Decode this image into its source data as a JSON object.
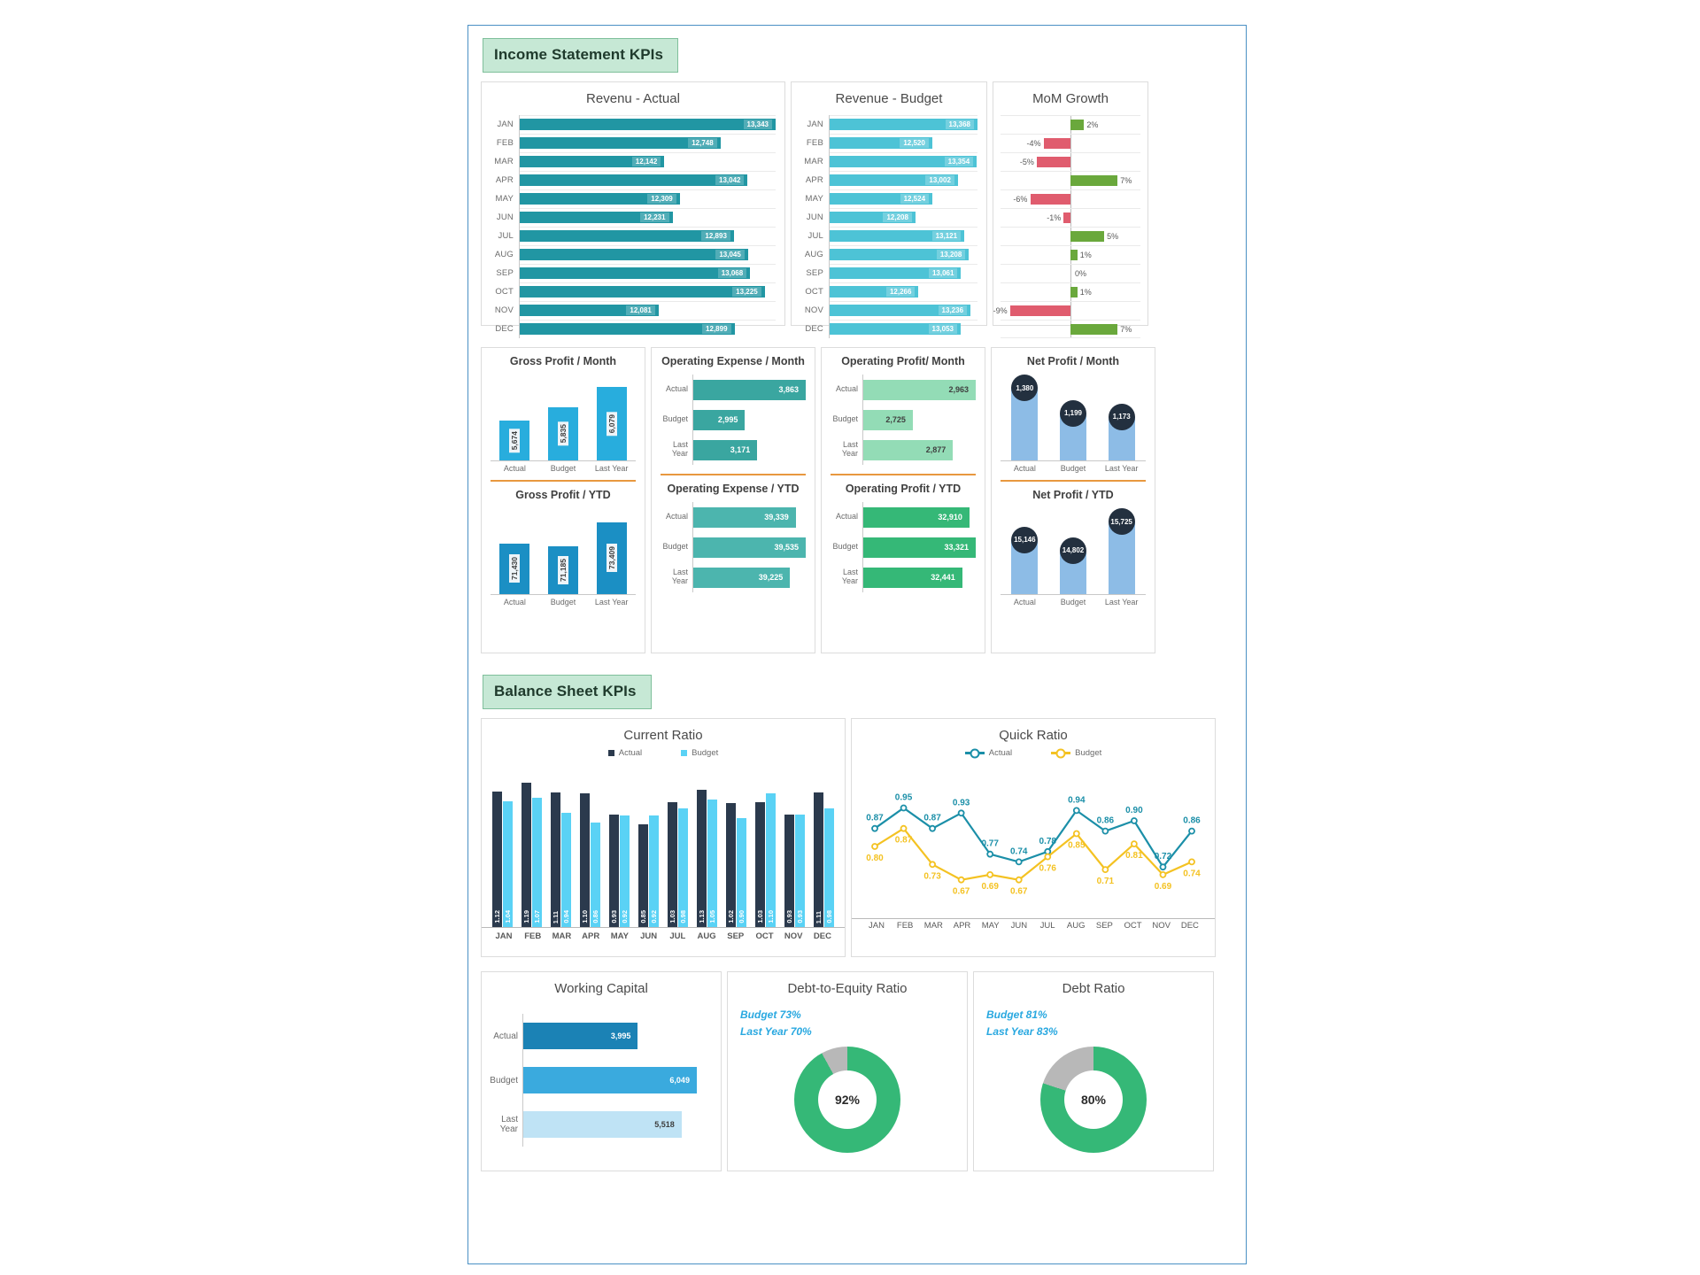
{
  "sections": {
    "income": "Income Statement KPIs",
    "balance": "Balance Sheet KPIs"
  },
  "titles": {
    "revenue_actual": "Revenu - Actual",
    "revenue_budget": "Revenue - Budget",
    "mom_growth": "MoM Growth",
    "gross_profit_month": "Gross Profit / Month",
    "gross_profit_ytd": "Gross Profit / YTD",
    "opex_month": "Operating Expense / Month",
    "opex_ytd": "Operating Expense / YTD",
    "opprofit_month": "Operating Profit/ Month",
    "opprofit_ytd": "Operating Profit / YTD",
    "netprofit_month": "Net Profit / Month",
    "netprofit_ytd": "Net Profit / YTD",
    "current_ratio": "Current Ratio",
    "quick_ratio": "Quick Ratio",
    "working_capital": "Working Capital",
    "debt_to_equity": "Debt-to-Equity Ratio",
    "debt_ratio": "Debt Ratio"
  },
  "legends": {
    "actual": "Actual",
    "budget": "Budget"
  },
  "cat_labels": {
    "actual": "Actual",
    "budget": "Budget",
    "last_year": "Last Year",
    "last_year_2l": "Last Year"
  },
  "colors": {
    "teal_dark": "#2196a3",
    "teal_light": "#4dc3d6",
    "green": "#6aa83c",
    "red": "#e05c6e",
    "blue_light": "#28addd",
    "blue_mid": "#1b8fc4",
    "navy": "#2b3a4d",
    "cyan": "#5ad2f5",
    "donut_green": "#35b877",
    "donut_grey": "#b8b8b8",
    "note_blue": "#29a8e0",
    "banner_green": "#c6e8d5",
    "divider_orange": "#e8983f"
  },
  "chart_data": [
    {
      "type": "bar",
      "title": "Revenu - Actual",
      "orientation": "horizontal",
      "categories": [
        "JAN",
        "FEB",
        "MAR",
        "APR",
        "MAY",
        "JUN",
        "JUL",
        "AUG",
        "SEP",
        "OCT",
        "NOV",
        "DEC"
      ],
      "values": [
        13343,
        12748,
        12142,
        13042,
        12309,
        12231,
        12893,
        13045,
        13068,
        13225,
        12081,
        12899
      ],
      "labels": [
        "13,343",
        "12,748",
        "12,142",
        "13,042",
        "12,309",
        "12,231",
        "12,893",
        "13,045",
        "13,068",
        "13,225",
        "12,081",
        "12,899"
      ],
      "xlabel": "",
      "ylabel": "",
      "grid": true,
      "legend": "none"
    },
    {
      "type": "bar",
      "title": "Revenue - Budget",
      "orientation": "horizontal",
      "categories": [
        "JAN",
        "FEB",
        "MAR",
        "APR",
        "MAY",
        "JUN",
        "JUL",
        "AUG",
        "SEP",
        "OCT",
        "NOV",
        "DEC"
      ],
      "values": [
        13368,
        12520,
        13354,
        13002,
        12524,
        12208,
        13121,
        13208,
        13061,
        12266,
        13236,
        13053
      ],
      "labels": [
        "13,368",
        "12,520",
        "13,354",
        "13,002",
        "12,524",
        "12,208",
        "13,121",
        "13,208",
        "13,061",
        "12,266",
        "13,236",
        "13,053"
      ],
      "xlabel": "",
      "ylabel": "",
      "grid": true,
      "legend": "none"
    },
    {
      "type": "bar",
      "title": "MoM Growth",
      "orientation": "horizontal-diverging",
      "categories": [
        "JAN",
        "FEB",
        "MAR",
        "APR",
        "MAY",
        "JUN",
        "JUL",
        "AUG",
        "SEP",
        "OCT",
        "NOV",
        "DEC"
      ],
      "values": [
        2,
        -4,
        -5,
        7,
        -6,
        -1,
        5,
        1,
        0,
        1,
        -9,
        7
      ],
      "labels": [
        "2%",
        "-4%",
        "-5%",
        "7%",
        "-6%",
        "-1%",
        "5%",
        "1%",
        "0%",
        "1%",
        "-9%",
        "7%"
      ],
      "xlabel": "",
      "ylabel": "",
      "grid": true,
      "legend": "none"
    },
    {
      "type": "bar",
      "title": "Gross Profit / Month",
      "orientation": "vertical",
      "categories": [
        "Actual",
        "Budget",
        "Last Year"
      ],
      "values": [
        5674,
        5835,
        6079
      ],
      "labels": [
        "5,674",
        "5,835",
        "6,079"
      ]
    },
    {
      "type": "bar",
      "title": "Gross Profit / YTD",
      "orientation": "vertical",
      "categories": [
        "Actual",
        "Budget",
        "Last Year"
      ],
      "values": [
        71430,
        71185,
        73409
      ],
      "labels": [
        "71,430",
        "71,185",
        "73,409"
      ]
    },
    {
      "type": "bar",
      "title": "Operating Expense / Month",
      "orientation": "horizontal",
      "categories": [
        "Actual",
        "Budget",
        "Last Year"
      ],
      "values": [
        3863,
        2995,
        3171
      ],
      "labels": [
        "3,863",
        "2,995",
        "3,171"
      ]
    },
    {
      "type": "bar",
      "title": "Operating Expense / YTD",
      "orientation": "horizontal",
      "categories": [
        "Actual",
        "Budget",
        "Last Year"
      ],
      "values": [
        39339,
        39535,
        39225
      ],
      "labels": [
        "39,339",
        "39,535",
        "39,225"
      ]
    },
    {
      "type": "bar",
      "title": "Operating Profit/ Month",
      "orientation": "horizontal",
      "categories": [
        "Actual",
        "Budget",
        "Last Year"
      ],
      "values": [
        2963,
        2725,
        2877
      ],
      "labels": [
        "2,963",
        "2,725",
        "2,877"
      ]
    },
    {
      "type": "bar",
      "title": "Operating Profit / YTD",
      "orientation": "horizontal",
      "categories": [
        "Actual",
        "Budget",
        "Last Year"
      ],
      "values": [
        32910,
        33321,
        32441
      ],
      "labels": [
        "32,910",
        "33,321",
        "32,441"
      ]
    },
    {
      "type": "bar",
      "title": "Net Profit / Month",
      "orientation": "vertical",
      "categories": [
        "Actual",
        "Budget",
        "Last Year"
      ],
      "values": [
        1380,
        1199,
        1173
      ],
      "labels": [
        "1,380",
        "1,199",
        "1,173"
      ]
    },
    {
      "type": "bar",
      "title": "Net Profit / YTD",
      "orientation": "vertical",
      "categories": [
        "Actual",
        "Budget",
        "Last Year"
      ],
      "values": [
        15146,
        14802,
        15725
      ],
      "labels": [
        "15,146",
        "14,802",
        "15,725"
      ]
    },
    {
      "type": "bar",
      "title": "Current Ratio",
      "orientation": "vertical-grouped",
      "categories": [
        "JAN",
        "FEB",
        "MAR",
        "APR",
        "MAY",
        "JUN",
        "JUL",
        "AUG",
        "SEP",
        "OCT",
        "NOV",
        "DEC"
      ],
      "series": [
        {
          "name": "Actual",
          "values": [
            1.12,
            1.19,
            1.11,
            1.1,
            0.93,
            0.85,
            1.03,
            1.13,
            1.02,
            1.03,
            0.93,
            1.11
          ]
        },
        {
          "name": "Budget",
          "values": [
            1.04,
            1.07,
            0.94,
            0.86,
            0.92,
            0.92,
            0.98,
            1.05,
            0.9,
            1.1,
            0.93,
            0.98
          ]
        }
      ],
      "labels": {
        "Actual": [
          "1.12",
          "1.19",
          "1.11",
          "1.10",
          "0.93",
          "0.85",
          "1.03",
          "1.13",
          "1.02",
          "1.03",
          "0.93",
          "1.11"
        ],
        "Budget": [
          "1.04",
          "1.07",
          "0.94",
          "0.86",
          "0.92",
          "0.92",
          "0.98",
          "1.05",
          "0.90",
          "1.10",
          "0.93",
          "0.98"
        ]
      },
      "legend": "top",
      "ylim": [
        0,
        1.3
      ]
    },
    {
      "type": "line",
      "title": "Quick Ratio",
      "categories": [
        "JAN",
        "FEB",
        "MAR",
        "APR",
        "MAY",
        "JUN",
        "JUL",
        "AUG",
        "SEP",
        "OCT",
        "NOV",
        "DEC"
      ],
      "series": [
        {
          "name": "Actual",
          "values": [
            0.87,
            0.95,
            0.87,
            0.93,
            0.77,
            0.74,
            0.78,
            0.94,
            0.86,
            0.9,
            0.72,
            0.86
          ]
        },
        {
          "name": "Budget",
          "values": [
            0.8,
            0.87,
            0.73,
            0.67,
            0.69,
            0.67,
            0.76,
            0.85,
            0.71,
            0.81,
            0.69,
            0.74
          ]
        }
      ],
      "labels": {
        "Actual": [
          "0.87",
          "0.95",
          "0.87",
          "0.93",
          "0.77",
          "0.74",
          "0.78",
          "0.94",
          "0.86",
          "0.90",
          "0.72",
          "0.86"
        ],
        "Budget": [
          "0.80",
          "0.87",
          "0.73",
          "0.67",
          "0.69",
          "0.67",
          "0.76",
          "0.85",
          "0.71",
          "0.81",
          "0.69",
          "0.74"
        ]
      },
      "legend": "top",
      "ylim": [
        0.6,
        1.0
      ]
    },
    {
      "type": "bar",
      "title": "Working Capital",
      "orientation": "horizontal",
      "categories": [
        "Actual",
        "Budget",
        "Last Year"
      ],
      "values": [
        3995,
        6049,
        5518
      ],
      "labels": [
        "3,995",
        "6,049",
        "5,518"
      ]
    },
    {
      "type": "pie",
      "title": "Debt-to-Equity Ratio",
      "subtype": "donut",
      "center_label": "92%",
      "values": [
        92,
        8
      ],
      "slice_names": [
        "Actual",
        "Remainder"
      ],
      "annotations": [
        "Budget 73%",
        "Last Year 70%"
      ]
    },
    {
      "type": "pie",
      "title": "Debt Ratio",
      "subtype": "donut",
      "center_label": "80%",
      "values": [
        80,
        20
      ],
      "slice_names": [
        "Actual",
        "Remainder"
      ],
      "annotations": [
        "Budget 81%",
        "Last Year 83%"
      ]
    }
  ],
  "donuts": {
    "dte": {
      "center": "92%",
      "note1": "Budget 73%",
      "note2": "Last Year 70%"
    },
    "dr": {
      "center": "80%",
      "note1": "Budget 81%",
      "note2": "Last Year 83%"
    }
  }
}
